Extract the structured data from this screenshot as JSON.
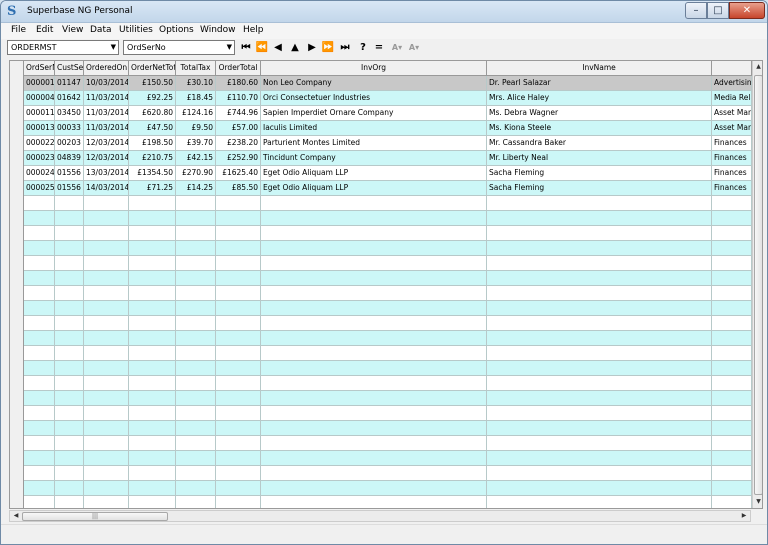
{
  "window": {
    "title": "Superbase NG Personal",
    "min_glyph": "–",
    "max_glyph": "□",
    "close_glyph": "✕"
  },
  "menu": [
    {
      "label": "File"
    },
    {
      "label": "Edit"
    },
    {
      "label": "View"
    },
    {
      "label": "Data"
    },
    {
      "label": "Utilities"
    },
    {
      "label": "Options"
    },
    {
      "label": "Window"
    },
    {
      "label": "Help"
    }
  ],
  "toolbar": {
    "table_select": "ORDERMST",
    "index_select": "OrdSerNo",
    "nav": {
      "first": "⏮",
      "prev_page": "⏪",
      "prev": "◀",
      "up": "▲",
      "next": "▶",
      "next_page": "⏩",
      "last": "⏭",
      "query": "?",
      "equals": "=",
      "filter_a": "A▾",
      "filter_b": "A▾"
    }
  },
  "grid": {
    "columns": [
      "OrdSerNo",
      "CustSerNo",
      "OrderedOn",
      "OrderNetTotal",
      "TotalTax",
      "OrderTotal",
      "InvOrg",
      "InvName",
      ""
    ],
    "rows": [
      [
        "000001",
        "01147",
        "10/03/2014",
        "£150.50",
        "£30.10",
        "£180.60",
        "Non Leo Company",
        "Dr. Pearl Salazar",
        "Advertising"
      ],
      [
        "000004",
        "01642",
        "11/03/2014",
        "£92.25",
        "£18.45",
        "£110.70",
        "Orci Consectetuer Industries",
        "Mrs. Alice Haley",
        "Media Relat"
      ],
      [
        "000011",
        "03450",
        "11/03/2014",
        "£620.80",
        "£124.16",
        "£744.96",
        "Sapien Imperdiet Ornare Company",
        "Ms. Debra Wagner",
        "Asset Mana"
      ],
      [
        "000013",
        "00033",
        "11/03/2014",
        "£47.50",
        "£9.50",
        "£57.00",
        "Iaculis Limited",
        "Ms. Kiona Steele",
        "Asset Mana"
      ],
      [
        "000022",
        "00203",
        "12/03/2014",
        "£198.50",
        "£39.70",
        "£238.20",
        "Parturient Montes Limited",
        "Mr. Cassandra Baker",
        "Finances"
      ],
      [
        "000023",
        "04839",
        "12/03/2014",
        "£210.75",
        "£42.15",
        "£252.90",
        "Tincidunt Company",
        "Mr. Liberty Neal",
        "Finances"
      ],
      [
        "000024",
        "01556",
        "13/03/2014",
        "£1354.50",
        "£270.90",
        "£1625.40",
        "Eget Odio Aliquam LLP",
        "Sacha Fleming",
        "Finances"
      ],
      [
        "000025",
        "01556",
        "14/03/2014",
        "£71.25",
        "£14.25",
        "£85.50",
        "Eget Odio Aliquam LLP",
        "Sacha Fleming",
        "Finances"
      ]
    ],
    "selected_row": 0
  },
  "colors": {
    "row_alt": "#ccf7f7",
    "row_selected": "#c8c8c8",
    "grid_line": "#b7c9c9"
  }
}
